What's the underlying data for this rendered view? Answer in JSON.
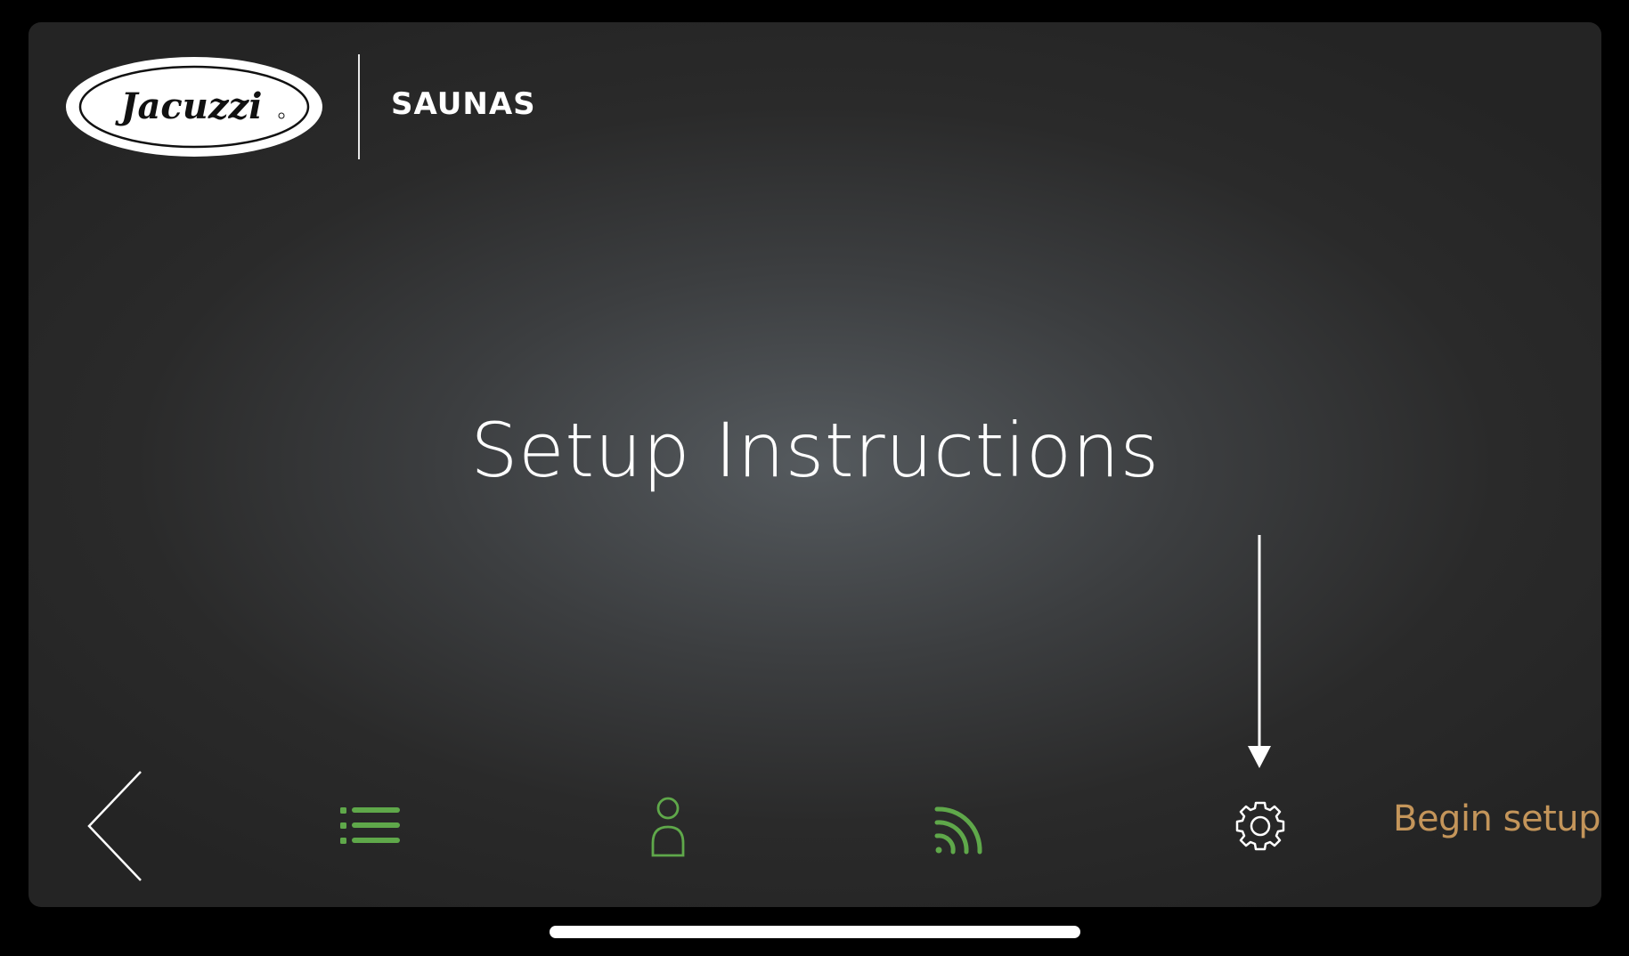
{
  "header": {
    "logo_text": "Jacuzzi",
    "brand_label": "SAUNAS"
  },
  "main": {
    "title": "Setup Instructions"
  },
  "nav": {
    "icons": [
      "back-chevron-icon",
      "list-menu-icon",
      "user-icon",
      "wifi-icon",
      "gear-icon"
    ],
    "begin_setup_label": "Begin setup"
  },
  "colors": {
    "accent_green": "#5fa84a",
    "begin_setup": "#c4955a",
    "icon_white": "#ffffff"
  }
}
